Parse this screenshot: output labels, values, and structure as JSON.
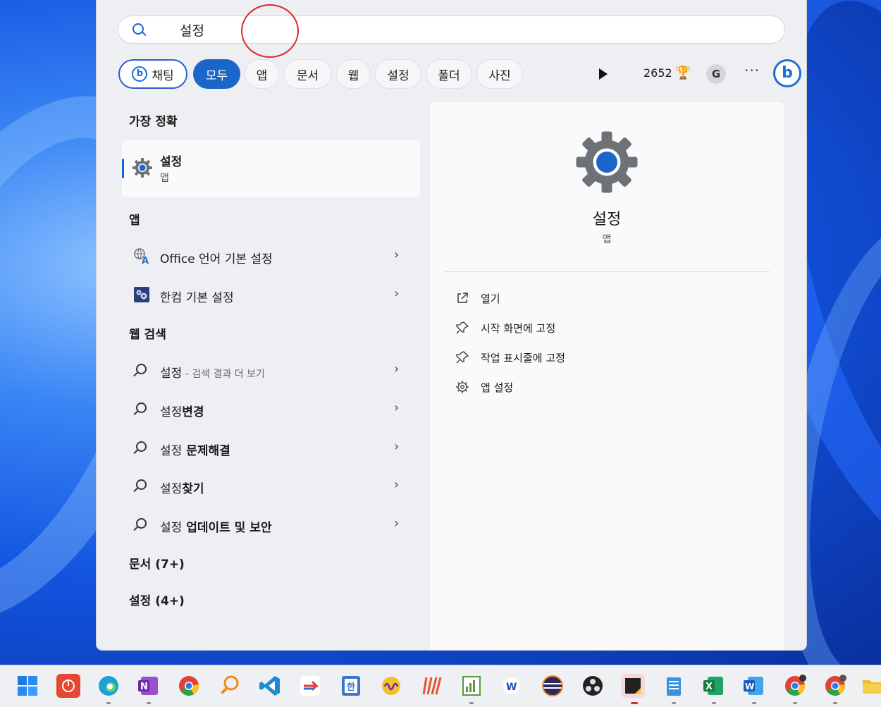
{
  "search": {
    "query": "설정"
  },
  "filters": {
    "chat_label": "채팅",
    "chat_b": "b",
    "chips": [
      "모두",
      "앱",
      "문서",
      "웹",
      "설정",
      "폴더",
      "사진"
    ],
    "points": "2652",
    "medal": "🏆",
    "avatar": "G",
    "more": "···",
    "copilot_b": "b"
  },
  "results": {
    "best_match_header": "가장 정확",
    "best_match": {
      "title": "설정",
      "subtitle": "앱"
    },
    "apps_header": "앱",
    "apps": [
      {
        "label": "Office 언어 기본 설정"
      },
      {
        "label": "한컴 기본 설정"
      }
    ],
    "web_header": "웹 검색",
    "web": [
      {
        "prefix": "설정",
        "muted": " - 검색 결과 더 보기",
        "bold": ""
      },
      {
        "prefix": "설정",
        "muted": "",
        "bold": "변경"
      },
      {
        "prefix": "설정",
        "muted": "",
        "bold": " 문제해결"
      },
      {
        "prefix": "설정",
        "muted": "",
        "bold": "찾기"
      },
      {
        "prefix": "설정",
        "muted": "",
        "bold": " 업데이트 및 보안"
      }
    ],
    "docs_header": "문서 (7+)",
    "settings_header": "설정 (4+)",
    "chevron": "›"
  },
  "detail": {
    "title": "설정",
    "subtitle": "앱",
    "actions": [
      "열기",
      "시작 화면에 고정",
      "작업 표시줄에 고정",
      "앱 설정"
    ]
  },
  "colors": {
    "accent": "#1a67c9",
    "annotation": "#e0262b"
  }
}
